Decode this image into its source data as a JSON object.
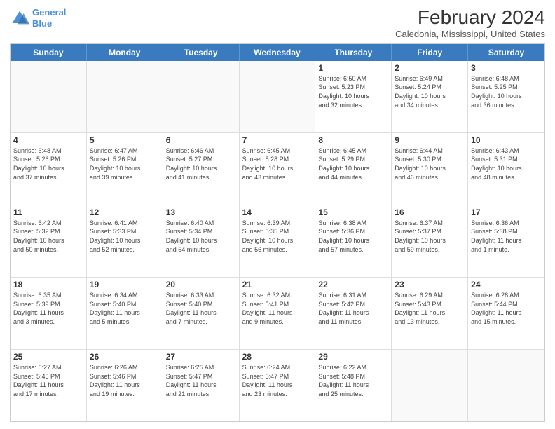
{
  "header": {
    "logo_line1": "General",
    "logo_line2": "Blue",
    "month_year": "February 2024",
    "location": "Caledonia, Mississippi, United States"
  },
  "days_of_week": [
    "Sunday",
    "Monday",
    "Tuesday",
    "Wednesday",
    "Thursday",
    "Friday",
    "Saturday"
  ],
  "weeks": [
    [
      {
        "day": "",
        "info": ""
      },
      {
        "day": "",
        "info": ""
      },
      {
        "day": "",
        "info": ""
      },
      {
        "day": "",
        "info": ""
      },
      {
        "day": "1",
        "info": "Sunrise: 6:50 AM\nSunset: 5:23 PM\nDaylight: 10 hours\nand 32 minutes."
      },
      {
        "day": "2",
        "info": "Sunrise: 6:49 AM\nSunset: 5:24 PM\nDaylight: 10 hours\nand 34 minutes."
      },
      {
        "day": "3",
        "info": "Sunrise: 6:48 AM\nSunset: 5:25 PM\nDaylight: 10 hours\nand 36 minutes."
      }
    ],
    [
      {
        "day": "4",
        "info": "Sunrise: 6:48 AM\nSunset: 5:26 PM\nDaylight: 10 hours\nand 37 minutes."
      },
      {
        "day": "5",
        "info": "Sunrise: 6:47 AM\nSunset: 5:26 PM\nDaylight: 10 hours\nand 39 minutes."
      },
      {
        "day": "6",
        "info": "Sunrise: 6:46 AM\nSunset: 5:27 PM\nDaylight: 10 hours\nand 41 minutes."
      },
      {
        "day": "7",
        "info": "Sunrise: 6:45 AM\nSunset: 5:28 PM\nDaylight: 10 hours\nand 43 minutes."
      },
      {
        "day": "8",
        "info": "Sunrise: 6:45 AM\nSunset: 5:29 PM\nDaylight: 10 hours\nand 44 minutes."
      },
      {
        "day": "9",
        "info": "Sunrise: 6:44 AM\nSunset: 5:30 PM\nDaylight: 10 hours\nand 46 minutes."
      },
      {
        "day": "10",
        "info": "Sunrise: 6:43 AM\nSunset: 5:31 PM\nDaylight: 10 hours\nand 48 minutes."
      }
    ],
    [
      {
        "day": "11",
        "info": "Sunrise: 6:42 AM\nSunset: 5:32 PM\nDaylight: 10 hours\nand 50 minutes."
      },
      {
        "day": "12",
        "info": "Sunrise: 6:41 AM\nSunset: 5:33 PM\nDaylight: 10 hours\nand 52 minutes."
      },
      {
        "day": "13",
        "info": "Sunrise: 6:40 AM\nSunset: 5:34 PM\nDaylight: 10 hours\nand 54 minutes."
      },
      {
        "day": "14",
        "info": "Sunrise: 6:39 AM\nSunset: 5:35 PM\nDaylight: 10 hours\nand 56 minutes."
      },
      {
        "day": "15",
        "info": "Sunrise: 6:38 AM\nSunset: 5:36 PM\nDaylight: 10 hours\nand 57 minutes."
      },
      {
        "day": "16",
        "info": "Sunrise: 6:37 AM\nSunset: 5:37 PM\nDaylight: 10 hours\nand 59 minutes."
      },
      {
        "day": "17",
        "info": "Sunrise: 6:36 AM\nSunset: 5:38 PM\nDaylight: 11 hours\nand 1 minute."
      }
    ],
    [
      {
        "day": "18",
        "info": "Sunrise: 6:35 AM\nSunset: 5:39 PM\nDaylight: 11 hours\nand 3 minutes."
      },
      {
        "day": "19",
        "info": "Sunrise: 6:34 AM\nSunset: 5:40 PM\nDaylight: 11 hours\nand 5 minutes."
      },
      {
        "day": "20",
        "info": "Sunrise: 6:33 AM\nSunset: 5:40 PM\nDaylight: 11 hours\nand 7 minutes."
      },
      {
        "day": "21",
        "info": "Sunrise: 6:32 AM\nSunset: 5:41 PM\nDaylight: 11 hours\nand 9 minutes."
      },
      {
        "day": "22",
        "info": "Sunrise: 6:31 AM\nSunset: 5:42 PM\nDaylight: 11 hours\nand 11 minutes."
      },
      {
        "day": "23",
        "info": "Sunrise: 6:29 AM\nSunset: 5:43 PM\nDaylight: 11 hours\nand 13 minutes."
      },
      {
        "day": "24",
        "info": "Sunrise: 6:28 AM\nSunset: 5:44 PM\nDaylight: 11 hours\nand 15 minutes."
      }
    ],
    [
      {
        "day": "25",
        "info": "Sunrise: 6:27 AM\nSunset: 5:45 PM\nDaylight: 11 hours\nand 17 minutes."
      },
      {
        "day": "26",
        "info": "Sunrise: 6:26 AM\nSunset: 5:46 PM\nDaylight: 11 hours\nand 19 minutes."
      },
      {
        "day": "27",
        "info": "Sunrise: 6:25 AM\nSunset: 5:47 PM\nDaylight: 11 hours\nand 21 minutes."
      },
      {
        "day": "28",
        "info": "Sunrise: 6:24 AM\nSunset: 5:47 PM\nDaylight: 11 hours\nand 23 minutes."
      },
      {
        "day": "29",
        "info": "Sunrise: 6:22 AM\nSunset: 5:48 PM\nDaylight: 11 hours\nand 25 minutes."
      },
      {
        "day": "",
        "info": ""
      },
      {
        "day": "",
        "info": ""
      }
    ]
  ]
}
